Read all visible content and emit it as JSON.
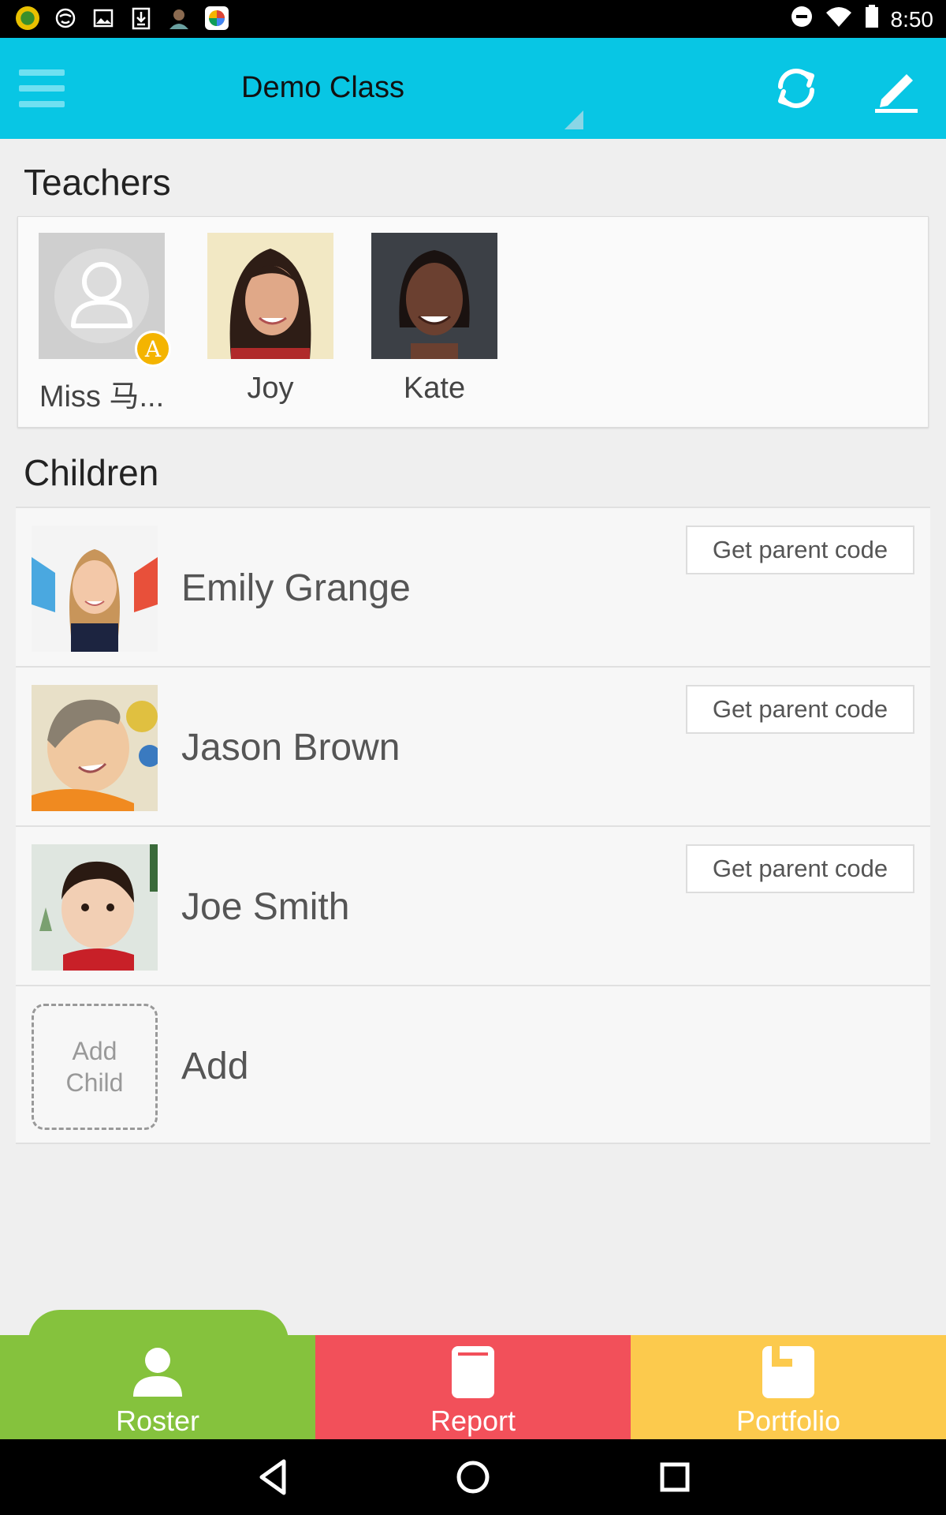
{
  "status_bar": {
    "time": "8:50"
  },
  "app_bar": {
    "class_name": "Demo Class"
  },
  "teachers": {
    "heading": "Teachers",
    "items": [
      {
        "name": "Miss 马...",
        "badge": "A"
      },
      {
        "name": "Joy"
      },
      {
        "name": "Kate"
      }
    ]
  },
  "children": {
    "heading": "Children",
    "items": [
      {
        "name": "Emily Grange",
        "button": "Get parent code"
      },
      {
        "name": "Jason Brown",
        "button": "Get parent code"
      },
      {
        "name": "Joe Smith",
        "button": "Get parent code"
      }
    ],
    "add": {
      "box_line1": "Add",
      "box_line2": "Child",
      "label": "Add"
    }
  },
  "tabs": [
    {
      "label": "Roster",
      "color": "#85c23d"
    },
    {
      "label": "Report",
      "color": "#f2505a"
    },
    {
      "label": "Portfolio",
      "color": "#fcca4d"
    }
  ],
  "colors": {
    "app_bar": "#08c6e4"
  }
}
